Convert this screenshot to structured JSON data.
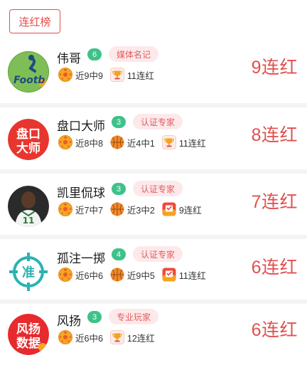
{
  "tab": {
    "label": "连红榜"
  },
  "colors": {
    "accent": "#e0504e",
    "level_badge": "#3ec28a",
    "tag_bg": "#fde9ea"
  },
  "experts": [
    {
      "name": "伟哥",
      "level": "6",
      "tag": "媒体名记",
      "avatar_icon": "football-logo-avatar",
      "avatar_text": "Footb",
      "stats": [
        {
          "icon": "soccer-ball-icon",
          "text": "近9中9"
        },
        {
          "icon": "trophy-icon",
          "text": "11连红"
        }
      ],
      "streak": "9连红"
    },
    {
      "name": "盘口大师",
      "level": "3",
      "tag": "认证专家",
      "avatar_icon": "text-logo-avatar",
      "avatar_text": [
        "盘口",
        "大师"
      ],
      "stats": [
        {
          "icon": "soccer-ball-icon",
          "text": "近8中8"
        },
        {
          "icon": "basketball-icon",
          "text": "近4中1"
        },
        {
          "icon": "trophy-icon",
          "text": "11连红"
        }
      ],
      "streak": "8连红"
    },
    {
      "name": "凯里侃球",
      "level": "3",
      "tag": "认证专家",
      "avatar_icon": "player-photo-avatar",
      "avatar_text": "11",
      "stats": [
        {
          "icon": "soccer-ball-icon",
          "text": "近7中7"
        },
        {
          "icon": "basketball-icon",
          "text": "近3中2"
        },
        {
          "icon": "calendar-badge-icon",
          "text": "9连红"
        }
      ],
      "streak": "7连红"
    },
    {
      "name": "孤注一掷",
      "level": "4",
      "tag": "认证专家",
      "avatar_icon": "crosshair-logo-avatar",
      "avatar_text": "准",
      "stats": [
        {
          "icon": "soccer-ball-icon",
          "text": "近6中6"
        },
        {
          "icon": "basketball-icon",
          "text": "近9中5"
        },
        {
          "icon": "calendar-badge-icon",
          "text": "11连红"
        }
      ],
      "streak": "6连红"
    },
    {
      "name": "风扬",
      "level": "3",
      "tag": "专业玩家",
      "avatar_icon": "text-logo-avatar",
      "avatar_text": [
        "风扬",
        "数据"
      ],
      "stats": [
        {
          "icon": "soccer-ball-icon",
          "text": "近6中6"
        },
        {
          "icon": "trophy-icon",
          "text": "12连红"
        }
      ],
      "streak": "6连红"
    }
  ]
}
